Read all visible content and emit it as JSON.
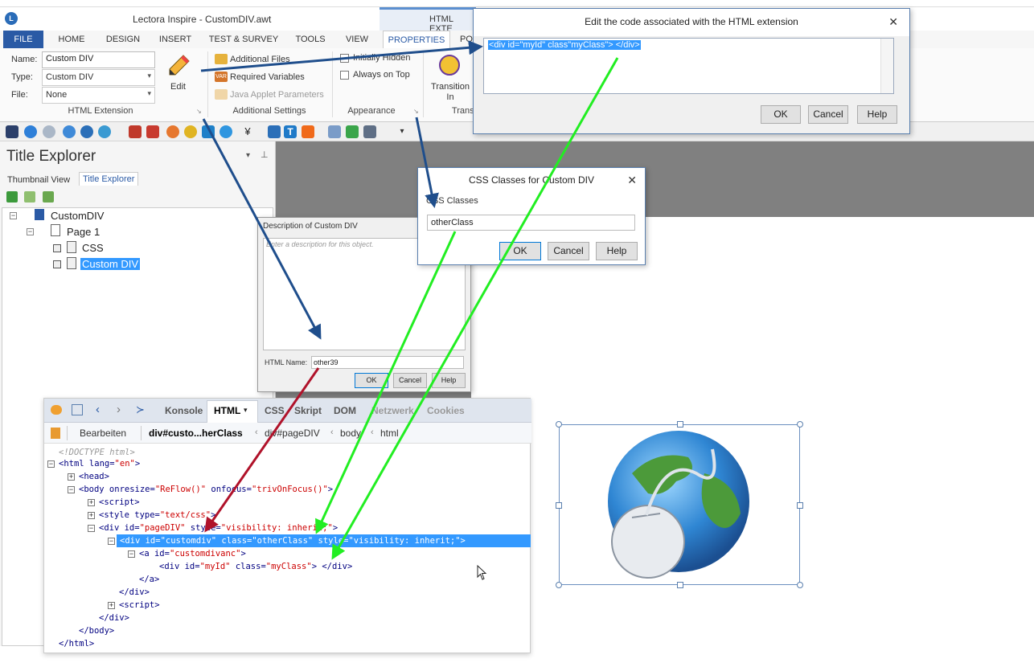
{
  "window": {
    "title": "Lectora Inspire - CustomDIV.awt",
    "contextual_tab": "HTML EXTE"
  },
  "ribbon_tabs": [
    "FILE",
    "HOME",
    "DESIGN",
    "INSERT",
    "TEST & SURVEY",
    "TOOLS",
    "VIEW",
    "PROPERTIES",
    "PO"
  ],
  "ribbon": {
    "name_label": "Name:",
    "name_value": "Custom DIV",
    "type_label": "Type:",
    "type_value": "Custom DIV",
    "file_label": "File:",
    "file_value": "None",
    "edit_label": "Edit",
    "group_html_extension": "HTML Extension",
    "additional_files": "Additional Files",
    "required_variables": "Required Variables",
    "java_applet_parameters": "Java Applet Parameters",
    "group_additional_settings": "Additional Settings",
    "initially_hidden": "Initially Hidden",
    "always_on_top": "Always on Top",
    "group_appearance": "Appearance",
    "transition_in": "Transition In",
    "group_transi": "Transi"
  },
  "left_panel": {
    "title": "Title Explorer",
    "tabs": [
      "Thumbnail View",
      "Title Explorer"
    ],
    "tree": {
      "root": "CustomDIV",
      "page": "Page 1",
      "item_css": "CSS",
      "item_div": "Custom DIV"
    }
  },
  "code_dialog": {
    "title": "Edit the code associated with the HTML extension",
    "code": "<div id=\"myId\" class\"myClass\"> </div>",
    "ok": "OK",
    "cancel": "Cancel",
    "help": "Help"
  },
  "css_dialog": {
    "title": "CSS Classes for Custom DIV",
    "label": "CSS Classes",
    "value": "otherClass",
    "ok": "OK",
    "cancel": "Cancel",
    "help": "Help"
  },
  "desc_dialog": {
    "title": "Description of Custom DIV",
    "placeholder": "Enter a description for this object.",
    "html_name_label": "HTML Name:",
    "html_name_value": "other39",
    "ok": "OK",
    "cancel": "Cancel",
    "help": "Help"
  },
  "firebug": {
    "tabs": [
      "Konsole",
      "HTML",
      "CSS",
      "Skript",
      "DOM",
      "Netzwerk",
      "Cookies"
    ],
    "breadcrumb": {
      "edit": "Bearbeiten",
      "b1": "div#custo...herClass",
      "b2": "div#pageDIV",
      "b3": "body",
      "b4": "html"
    },
    "lines": {
      "l1": "<!DOCTYPE html>",
      "l2a": "<html lang=",
      "l2b": "\"en\"",
      "l2c": ">",
      "l3": "<head>",
      "l4a": "<body onresize=",
      "l4b": "\"ReFlow()\"",
      "l4c": " onfocus=",
      "l4d": "\"trivOnFocus()\"",
      "l4e": ">",
      "l5": "<script>",
      "l6a": "<style type=",
      "l6b": "\"text/css\"",
      "l6c": ">",
      "l7a": "<div id=",
      "l7b": "\"pageDIV\"",
      "l7c": " style=",
      "l7d": "\"visibility: inherit;\"",
      "l7e": ">",
      "l8": "<div id=\"customdiv\" class=\"otherClass\" style=\"visibility: inherit;\">",
      "l9a": "<a id=",
      "l9b": "\"customdivanc\"",
      "l9c": ">",
      "l10a": "<div id=",
      "l10b": "\"myId\"",
      "l10c": " class=",
      "l10d": "\"myClass\"",
      "l10e": ">  </div>",
      "l11": "</a>",
      "l12": "</div>",
      "l13": "<script>",
      "l14": "</div>",
      "l15": "</body>",
      "l16": "</html>"
    }
  },
  "colors": {
    "accent": "#2a5aa5",
    "arrow_blue": "#1f4e8c",
    "arrow_green": "#22ee22",
    "arrow_red": "#b0122a",
    "selection": "#3399ff"
  }
}
